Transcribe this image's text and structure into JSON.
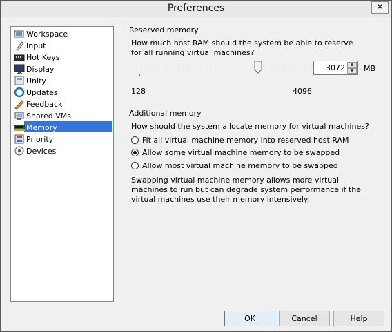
{
  "window": {
    "title": "Preferences",
    "close_glyph": "✕"
  },
  "sidebar": {
    "items": [
      {
        "label": "Workspace",
        "icon": "workspace-icon"
      },
      {
        "label": "Input",
        "icon": "input-icon"
      },
      {
        "label": "Hot Keys",
        "icon": "hotkeys-icon"
      },
      {
        "label": "Display",
        "icon": "display-icon"
      },
      {
        "label": "Unity",
        "icon": "unity-icon"
      },
      {
        "label": "Updates",
        "icon": "updates-icon"
      },
      {
        "label": "Feedback",
        "icon": "feedback-icon"
      },
      {
        "label": "Shared VMs",
        "icon": "shared-vms-icon"
      },
      {
        "label": "Memory",
        "icon": "memory-icon",
        "selected": true
      },
      {
        "label": "Priority",
        "icon": "priority-icon"
      },
      {
        "label": "Devices",
        "icon": "devices-icon"
      }
    ]
  },
  "reserved": {
    "heading": "Reserved memory",
    "question": "How much host RAM should the system be able to reserve for all running virtual machines?",
    "slider_min": "128",
    "slider_max": "4096",
    "value": "3072",
    "unit": "MB"
  },
  "additional": {
    "heading": "Additional memory",
    "question": "How should the system allocate memory for virtual machines?",
    "options": [
      {
        "label": "Fit all virtual machine memory into reserved host RAM",
        "checked": false
      },
      {
        "label": "Allow some virtual machine memory to be swapped",
        "checked": true
      },
      {
        "label": "Allow most virtual machine memory to be swapped",
        "checked": false
      }
    ],
    "note": "Swapping virtual machine memory allows more virtual machines to run but can degrade system performance if the virtual machines use their memory intensively."
  },
  "buttons": {
    "ok": "OK",
    "cancel": "Cancel",
    "help": "Help"
  },
  "colors": {
    "selection": "#3874d8"
  }
}
